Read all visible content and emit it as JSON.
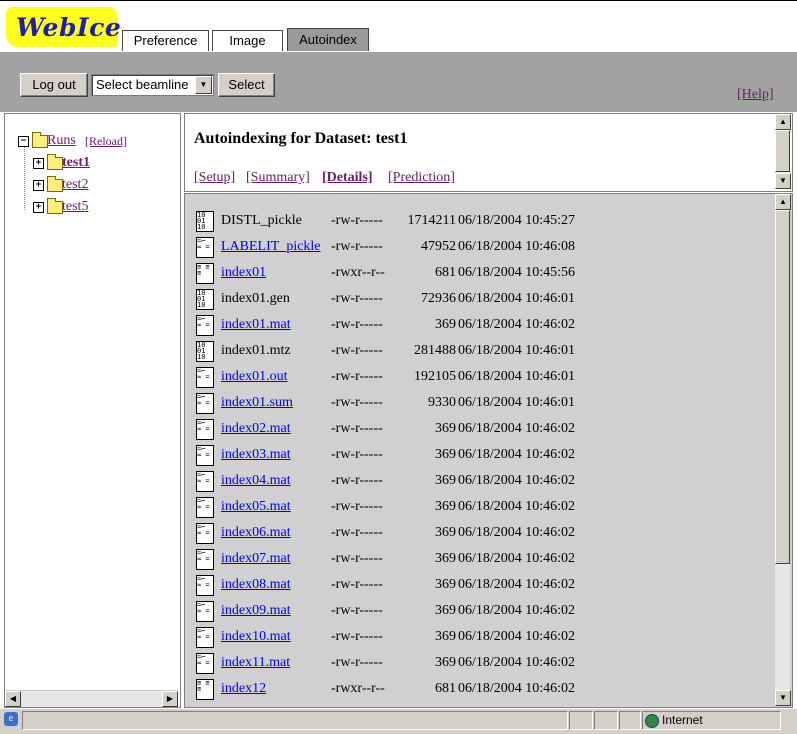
{
  "logo": {
    "text": "WebIce"
  },
  "tabs": [
    {
      "label": "Preference"
    },
    {
      "label": "Image"
    },
    {
      "label": "Autoindex"
    }
  ],
  "toolbar": {
    "logout_label": "Log out",
    "beamline_select": "Select beamline",
    "select_label": "Select",
    "help_label": "[Help]"
  },
  "tree": {
    "root_label": "Runs",
    "reload_label": "[Reload]",
    "items": [
      {
        "label": "test1",
        "bold": true
      },
      {
        "label": "test2"
      },
      {
        "label": "test5"
      }
    ]
  },
  "dataset": {
    "title": "Autoindexing for Dataset: test1",
    "links": [
      "[Setup]",
      "[Summary]",
      "[Details]",
      "[Prediction]"
    ]
  },
  "files": [
    {
      "name": "DISTL_pickle",
      "perm": "-rw-r-----",
      "size": "1714211",
      "date": "06/18/2004 10:45:27",
      "icon": "binary-file-icon",
      "link": false
    },
    {
      "name": "LABELIT_pickle",
      "perm": "-rw-r-----",
      "size": "47952",
      "date": "06/18/2004 10:46:08",
      "icon": "script-file-icon",
      "link": true
    },
    {
      "name": "index01",
      "perm": "-rwxr--r--",
      "size": "681",
      "date": "06/18/2004 10:45:56",
      "icon": "text-file-icon",
      "link": true
    },
    {
      "name": "index01.gen",
      "perm": "-rw-r-----",
      "size": "72936",
      "date": "06/18/2004 10:46:01",
      "icon": "binary-file-icon",
      "link": false
    },
    {
      "name": "index01.mat",
      "perm": "-rw-r-----",
      "size": "369",
      "date": "06/18/2004 10:46:02",
      "icon": "script-file-icon",
      "link": true
    },
    {
      "name": "index01.mtz",
      "perm": "-rw-r-----",
      "size": "281488",
      "date": "06/18/2004 10:46:01",
      "icon": "binary-file-icon",
      "link": false
    },
    {
      "name": "index01.out",
      "perm": "-rw-r-----",
      "size": "192105",
      "date": "06/18/2004 10:46:01",
      "icon": "script-file-icon",
      "link": true
    },
    {
      "name": "index01.sum",
      "perm": "-rw-r-----",
      "size": "9330",
      "date": "06/18/2004 10:46:01",
      "icon": "script-file-icon",
      "link": true
    },
    {
      "name": "index02.mat",
      "perm": "-rw-r-----",
      "size": "369",
      "date": "06/18/2004 10:46:02",
      "icon": "script-file-icon",
      "link": true
    },
    {
      "name": "index03.mat",
      "perm": "-rw-r-----",
      "size": "369",
      "date": "06/18/2004 10:46:02",
      "icon": "script-file-icon",
      "link": true
    },
    {
      "name": "index04.mat",
      "perm": "-rw-r-----",
      "size": "369",
      "date": "06/18/2004 10:46:02",
      "icon": "script-file-icon",
      "link": true
    },
    {
      "name": "index05.mat",
      "perm": "-rw-r-----",
      "size": "369",
      "date": "06/18/2004 10:46:02",
      "icon": "script-file-icon",
      "link": true
    },
    {
      "name": "index06.mat",
      "perm": "-rw-r-----",
      "size": "369",
      "date": "06/18/2004 10:46:02",
      "icon": "script-file-icon",
      "link": true
    },
    {
      "name": "index07.mat",
      "perm": "-rw-r-----",
      "size": "369",
      "date": "06/18/2004 10:46:02",
      "icon": "script-file-icon",
      "link": true
    },
    {
      "name": "index08.mat",
      "perm": "-rw-r-----",
      "size": "369",
      "date": "06/18/2004 10:46:02",
      "icon": "script-file-icon",
      "link": true
    },
    {
      "name": "index09.mat",
      "perm": "-rw-r-----",
      "size": "369",
      "date": "06/18/2004 10:46:02",
      "icon": "script-file-icon",
      "link": true
    },
    {
      "name": "index10.mat",
      "perm": "-rw-r-----",
      "size": "369",
      "date": "06/18/2004 10:46:02",
      "icon": "script-file-icon",
      "link": true
    },
    {
      "name": "index11.mat",
      "perm": "-rw-r-----",
      "size": "369",
      "date": "06/18/2004 10:46:02",
      "icon": "script-file-icon",
      "link": true
    },
    {
      "name": "index12",
      "perm": "-rwxr--r--",
      "size": "681",
      "date": "06/18/2004 10:46:02",
      "icon": "text-file-icon",
      "link": true
    }
  ],
  "status": {
    "zone": "Internet"
  },
  "colors": {
    "visited_link": "#6b1b6b",
    "link": "#0000ee",
    "toolbar_bg": "#a2a2a2",
    "logo_bg": "#ffff1e"
  }
}
